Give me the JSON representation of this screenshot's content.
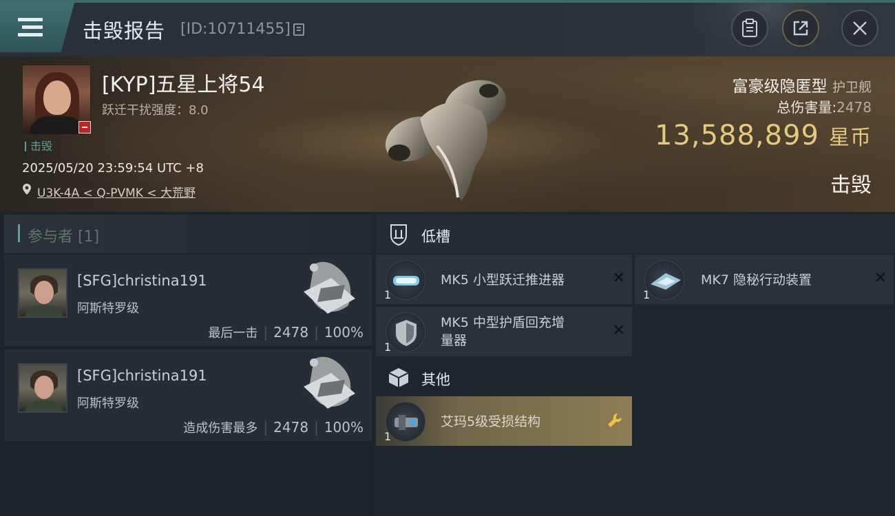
{
  "header": {
    "title": "击毁报告",
    "id_text": "[ID:10711455]"
  },
  "victim": {
    "name": "[KYP]五星上将54",
    "warp_label": "跃迁干扰强度：8.0",
    "kill_tag": "击毁",
    "timestamp": "2025/05/20 23:59:54 UTC +8",
    "location": "U3K-4A < Q-PVMK < 大荒野",
    "ship_class": "富豪级隐匿型",
    "ship_type": "护卫舰",
    "damage_label": "总伤害量:",
    "damage_value": "2478",
    "isk_value": "13,588,899",
    "isk_unit": "星币",
    "status": "击毁"
  },
  "participants": {
    "title": "参与者 [1]",
    "items": [
      {
        "name": "[SFG]christina191",
        "ship": "阿斯特罗级",
        "label": "最后一击",
        "damage": "2478",
        "percent": "100%"
      },
      {
        "name": "[SFG]christina191",
        "ship": "阿斯特罗级",
        "label": "造成伤害最多",
        "damage": "2478",
        "percent": "100%"
      }
    ]
  },
  "modules": {
    "low_slot_title": "低槽",
    "other_title": "其他",
    "low_slots": [
      {
        "name": "MK5 小型跃迁推进器",
        "qty": "1",
        "status": "destroyed"
      },
      {
        "name": "MK7 隐秘行动装置",
        "qty": "1",
        "status": "destroyed"
      },
      {
        "name_line1": "MK5 中型护盾回充增",
        "name_line2": "量器",
        "qty": "1",
        "status": "destroyed"
      }
    ],
    "other": [
      {
        "name": "艾玛5级受损结构",
        "qty": "1",
        "status": "dropped"
      }
    ]
  },
  "colors": {
    "accent_teal": "#3f6f70",
    "isk_gold": "#e6c87f",
    "dropped_gold": "#8c7d54",
    "badge_red": "#c4211f"
  },
  "icons": [
    "menu-icon",
    "copy-icon",
    "clipboard-icon",
    "share-icon",
    "close-icon",
    "location-pin-icon",
    "low-slot-icon",
    "cargo-box-icon",
    "destroyed-x-icon",
    "wrench-icon"
  ]
}
